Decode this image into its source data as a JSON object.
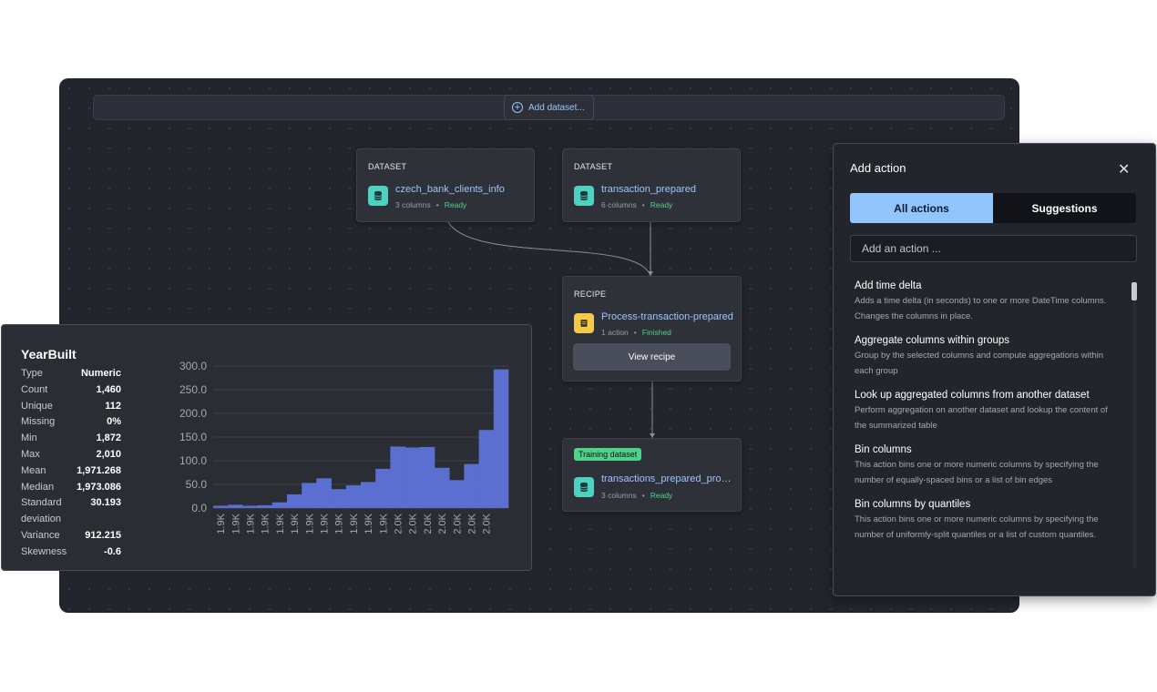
{
  "toolbar": {
    "add_dataset_label": "Add dataset..."
  },
  "nodes": {
    "dataset1": {
      "type": "DATASET",
      "name": "czech_bank_clients_info",
      "meta": "3 columns",
      "status": "Ready"
    },
    "dataset2": {
      "type": "DATASET",
      "name": "transaction_prepared",
      "meta": "6 columns",
      "status": "Ready"
    },
    "recipe": {
      "type": "RECIPE",
      "name": "Process-transaction-prepared",
      "meta": "1 action",
      "status": "Finished",
      "button": "View recipe"
    },
    "training": {
      "badge": "Training dataset",
      "name": "transactions_prepared_proc...",
      "meta": "3 columns",
      "status": "Ready"
    }
  },
  "stats": {
    "title": "YearBuilt",
    "rows": [
      {
        "k": "Type",
        "v": "Numeric"
      },
      {
        "k": "Count",
        "v": "1,460"
      },
      {
        "k": "Unique",
        "v": "112"
      },
      {
        "k": "Missing",
        "v": "0%"
      },
      {
        "k": "Min",
        "v": "1,872"
      },
      {
        "k": "Max",
        "v": "2,010"
      },
      {
        "k": "Mean",
        "v": "1,971.268"
      },
      {
        "k": "Median",
        "v": "1,973.086"
      },
      {
        "k": "Standard",
        "v": "30.193"
      },
      {
        "k": "deviation",
        "v": ""
      },
      {
        "k": "Variance",
        "v": "912.215"
      },
      {
        "k": "Skewness",
        "v": "-0.6"
      }
    ]
  },
  "chart_data": {
    "type": "bar",
    "title": "",
    "xlabel": "",
    "ylabel": "",
    "ylim": [
      0,
      300
    ],
    "yticks": [
      "0.0",
      "50.0",
      "100.0",
      "150.0",
      "200.0",
      "250.0",
      "300.0"
    ],
    "categories": [
      "1.9K",
      "1.9K",
      "1.9K",
      "1.9K",
      "1.9K",
      "1.9K",
      "1.9K",
      "1.9K",
      "1.9K",
      "1.9K",
      "1.9K",
      "1.9K",
      "2.0K",
      "2.0K",
      "2.0K",
      "2.0K",
      "2.0K",
      "2.0K",
      "2.0K"
    ],
    "values": [
      5,
      7,
      5,
      6,
      12,
      29,
      53,
      63,
      40,
      48,
      55,
      83,
      130,
      128,
      129,
      85,
      59,
      93,
      165,
      293
    ],
    "bar_color": "#5a6fd0"
  },
  "action_panel": {
    "title": "Add action",
    "tabs": [
      "All actions",
      "Suggestions"
    ],
    "search_placeholder": "Add an action ...",
    "items": [
      {
        "title": "Add time delta",
        "desc": "Adds a time delta (in seconds) to one or more DateTime columns. Changes the columns in place."
      },
      {
        "title": "Aggregate columns within groups",
        "desc": "Group by the selected columns and compute aggregations within each group"
      },
      {
        "title": "Look up aggregated columns from another dataset",
        "desc": "Perform aggregation on another dataset and lookup the content of the summarized table"
      },
      {
        "title": "Bin columns",
        "desc": "This action bins one or more numeric columns by specifying the number of equally-spaced bins or a list of bin edges"
      },
      {
        "title": "Bin columns by quantiles",
        "desc": "This action bins one or more numeric columns by specifying the number of uniformly-split quantiles or a list of custom quantiles."
      }
    ]
  },
  "colors": {
    "accent": "#93c5fd",
    "link": "#9bc5ff",
    "ready": "#4fd38a",
    "dataset_icon": "#4fd1c1",
    "recipe_icon": "#f2c94c"
  },
  "icons": {
    "add": "plus-circle-icon",
    "dataset": "database-icon",
    "recipe": "recipe-icon",
    "close": "close-icon"
  }
}
